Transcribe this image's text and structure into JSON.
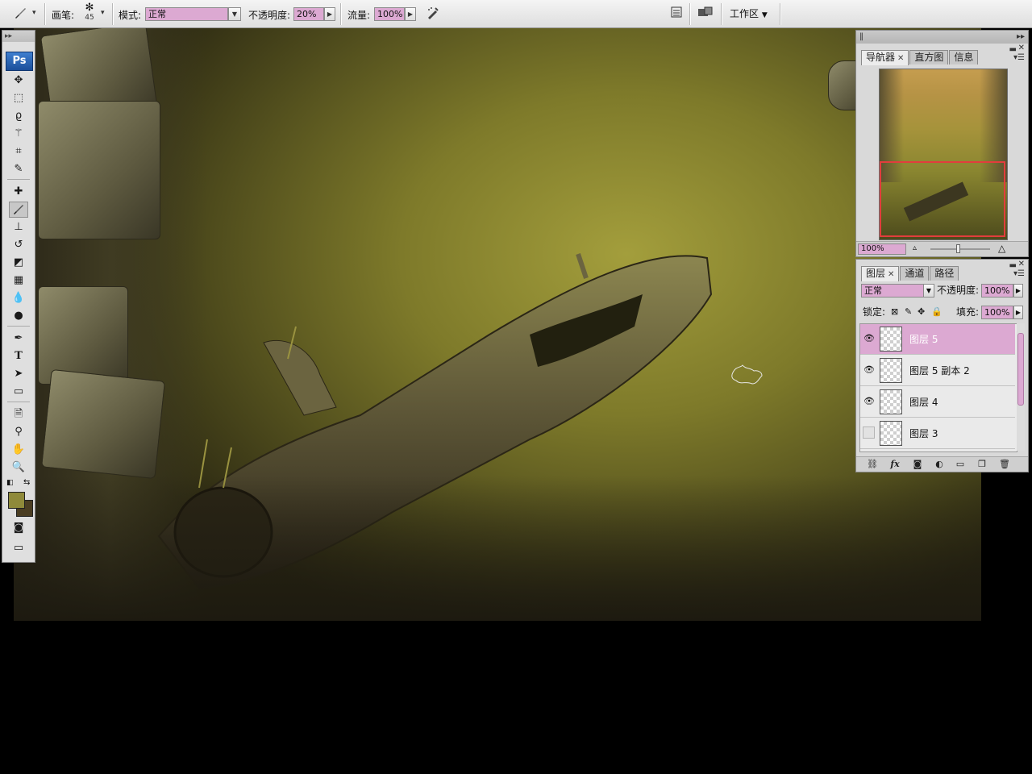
{
  "options_bar": {
    "brush_label": "画笔:",
    "brush_size": "45",
    "mode_label": "模式:",
    "mode_value": "正常",
    "opacity_label": "不透明度:",
    "opacity_value": "20%",
    "flow_label": "流量:",
    "flow_value": "100%",
    "workspace_label": "工作区",
    "icons": [
      "brush-tool-icon",
      "brush-preset-icon",
      "airbrush-icon",
      "palette-well-icon",
      "bridge-icon"
    ]
  },
  "toolbox": {
    "logo": "Ps",
    "tools": [
      "move-tool",
      "marquee-tool",
      "lasso-tool",
      "magic-wand-tool",
      "crop-tool",
      "slice-tool",
      "healing-brush-tool",
      "brush-tool",
      "clone-stamp-tool",
      "history-brush-tool",
      "eraser-tool",
      "gradient-tool",
      "blur-tool",
      "dodge-tool",
      "pen-tool",
      "type-tool",
      "path-selection-tool",
      "shape-tool",
      "notes-tool",
      "eyedropper-tool",
      "hand-tool",
      "zoom-tool"
    ],
    "active_tool": "brush-tool",
    "foreground_color": "#8f8a3a",
    "background_color": "#4a3d22"
  },
  "navigator": {
    "tabs": [
      "导航器",
      "直方图",
      "信息"
    ],
    "active_tab": "导航器",
    "zoom": "100%"
  },
  "layers": {
    "tabs": [
      "图层",
      "通道",
      "路径"
    ],
    "active_tab": "图层",
    "blend_mode": "正常",
    "opacity_label": "不透明度:",
    "opacity_value": "100%",
    "lock_label": "锁定:",
    "fill_label": "填充:",
    "fill_value": "100%",
    "items": [
      {
        "name": "图层 5",
        "visible": true,
        "selected": true
      },
      {
        "name": "图层 5 副本 2",
        "visible": true,
        "selected": false
      },
      {
        "name": "图层 4",
        "visible": true,
        "selected": false
      },
      {
        "name": "图层 3",
        "visible": false,
        "selected": false
      }
    ],
    "footer_icons": [
      "link-layers-icon",
      "layer-style-fx-icon",
      "layer-mask-icon",
      "adjustment-layer-icon",
      "new-group-icon",
      "new-layer-icon",
      "delete-layer-icon"
    ]
  },
  "colors": {
    "accent_pink": "#dca9d2",
    "panel_gray": "#d9d9d9",
    "canvas_olive": "#8f8a3a"
  }
}
